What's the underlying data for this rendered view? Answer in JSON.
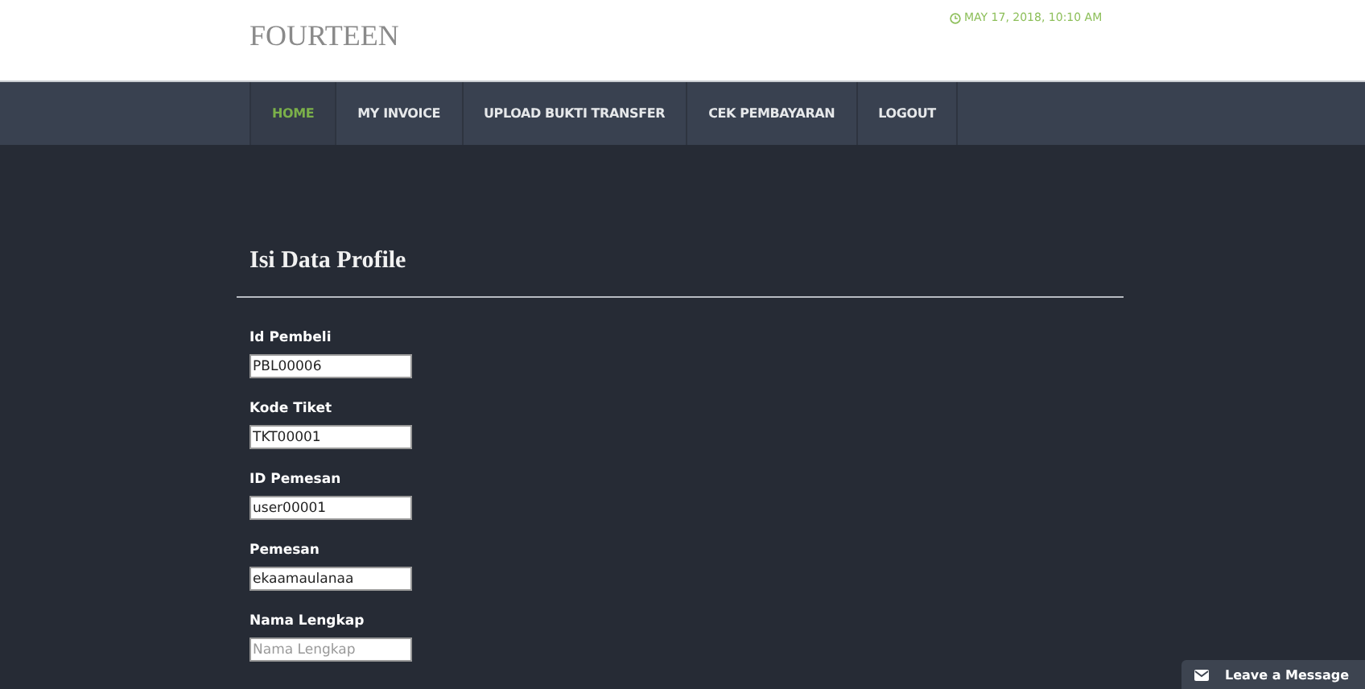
{
  "site_title": "FOURTEEN",
  "date": "MAY 17, 2018, 10:10 AM",
  "nav": [
    {
      "label": "HOME",
      "selected": true
    },
    {
      "label": "MY INVOICE",
      "selected": false
    },
    {
      "label": "UPLOAD BUKTI TRANSFER",
      "selected": false
    },
    {
      "label": "CEK PEMBAYARAN",
      "selected": false
    },
    {
      "label": "LOGOUT",
      "selected": false
    }
  ],
  "heading": "Isi Data Profile",
  "fields": [
    {
      "label": "Id Pembeli",
      "value": "PBL00006"
    },
    {
      "label": "Kode Tiket",
      "value": "TKT00001"
    },
    {
      "label": "ID Pemesan",
      "value": "user00001"
    },
    {
      "label": "Pemesan",
      "value": "ekaamaulanaa"
    },
    {
      "label": "Nama Lengkap",
      "placeholder": "Nama Lengkap"
    }
  ],
  "chat_button": "Leave a Message"
}
